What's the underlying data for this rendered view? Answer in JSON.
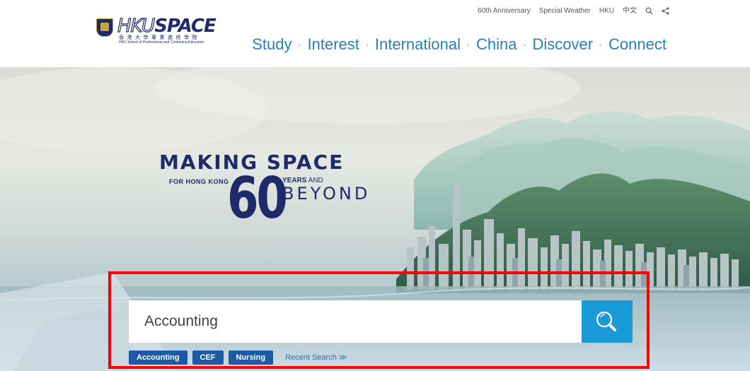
{
  "brand": {
    "logo_prefix": "HKU",
    "logo_suffix": "SPACE",
    "chinese_name": "香港大學專業進修學院",
    "english_name": "HKU School of Professional and Continuing Education"
  },
  "utility_nav": {
    "items": [
      "60th Anniversary",
      "Special Weather",
      "HKU",
      "中文"
    ],
    "icons": [
      "search-icon",
      "share-icon"
    ]
  },
  "main_nav": {
    "items": [
      "Study",
      "Interest",
      "International",
      "China",
      "Discover",
      "Connect"
    ],
    "separator": "·"
  },
  "hero": {
    "line1": "MAKING SPACE",
    "for_text": "FOR HONG KONG",
    "number": "60",
    "years": "YEARS",
    "and": " AND",
    "beyond": "BEYOND"
  },
  "search": {
    "value": "Accounting",
    "button_icon": "search-icon",
    "tags": [
      "Accounting",
      "CEF",
      "Nursing"
    ],
    "recent_label": "Recent Search ≫"
  },
  "colors": {
    "nav_blue": "#2a7fb8",
    "brand_navy": "#1f2a6b",
    "search_button": "#1a9ad6",
    "tag_bg": "#1d5aa6",
    "highlight": "#ff0000"
  }
}
